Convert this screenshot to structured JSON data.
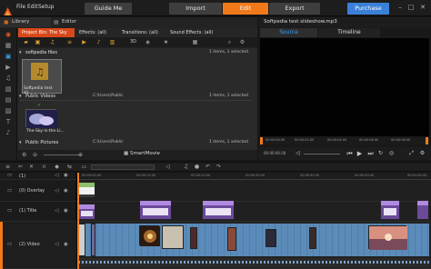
{
  "menu": {
    "file": "File",
    "edit": "Edit",
    "setup": "Setup"
  },
  "nav": {
    "guide": "Guide Me",
    "import": "Import",
    "edit": "Edit",
    "export": "Export",
    "purchase": "Purchase"
  },
  "library": {
    "library_tab": "Library",
    "editor_tab": "Editor",
    "panel_tabs": [
      "Project Bin: The Sky is...",
      "Effects: (all)",
      "Transitions: (all)",
      "Sound Effects: (all)"
    ],
    "groups": [
      {
        "name": "softpedia files",
        "path": "",
        "count": "1 items, 1 selected"
      },
      {
        "name": "Public Videos",
        "path": "C:\\Users\\Public",
        "count": "1 items, 1 selected"
      },
      {
        "name": "Public Pictures",
        "path": "C:\\Users\\Public",
        "count": "1 items, 1 selected"
      }
    ],
    "thumbs": [
      "Softpedia test sli...",
      "The-Sky-is-the-Li..."
    ],
    "footer": "SmartMovie"
  },
  "player": {
    "title": "Softpedia test slideshow.mp3",
    "tabs": [
      "Source",
      "Timeline"
    ],
    "timecodes": [
      "00:00:00.00",
      "00:00:02.00",
      "00:00:04.00",
      "00:00:06.00",
      "00:00:08.00",
      "00:00:10.00"
    ],
    "current_time": "00:00:00.00"
  },
  "timeline": {
    "tracks": [
      {
        "name": "(1)"
      },
      {
        "name": "(0) Overlay"
      },
      {
        "name": "(1) Title"
      },
      {
        "name": "(2) Video"
      }
    ],
    "ruler": [
      "00:00:00.00",
      "00:00:10.00",
      "00:00:20.00",
      "00:00:30.00",
      "00:00:40.00",
      "00:00:50.00",
      "00:01:00.00"
    ]
  },
  "colors": {
    "accent_orange": "#f07a1a",
    "purchase_blue": "#3a80d8",
    "selected_tab": "#d8481a",
    "clip_purple": "#8b5fc9",
    "clip_blue": "#5b8bb8"
  }
}
